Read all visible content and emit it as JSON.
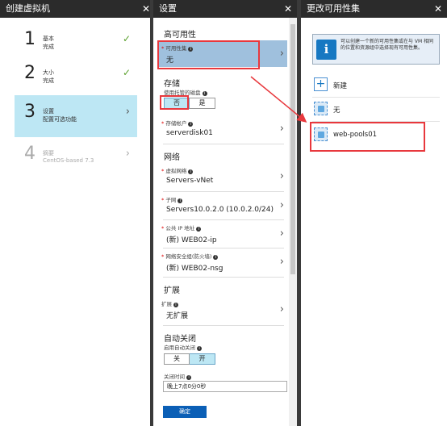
{
  "blade1": {
    "title": "创建虚拟机",
    "steps": [
      {
        "num": "1",
        "title": "基本",
        "sub": "完成"
      },
      {
        "num": "2",
        "title": "大小",
        "sub": "完成"
      },
      {
        "num": "3",
        "title": "设置",
        "sub": "配置可选功能"
      },
      {
        "num": "4",
        "title": "摘要",
        "sub": "CentOS-based 7.3"
      }
    ]
  },
  "blade2": {
    "title": "设置",
    "ha_section": "高可用性",
    "availability_set_label": "可用性集",
    "availability_set_value": "无",
    "storage_section": "存储",
    "managed_disk_label": "使用托管的磁盘",
    "managed_no": "否",
    "managed_yes": "是",
    "storage_account_label": "存储帐户",
    "storage_account_value": "serverdisk01",
    "network_section": "网络",
    "vnet_label": "虚拟网络",
    "vnet_value": "Servers-vNet",
    "subnet_label": "子网",
    "subnet_value": "Servers10.0.2.0 (10.0.2.0/24)",
    "public_ip_label": "公共 IP 地址",
    "public_ip_value": "(新) WEB02-ip",
    "nsg_label": "网络安全组(防火墙)",
    "nsg_value": "(新) WEB02-nsg",
    "ext_section": "扩展",
    "ext_label": "扩展",
    "ext_value": "无扩展",
    "autoshutdown_section": "自动关闭",
    "autoshutdown_label": "启用自动关闭",
    "off": "关",
    "on": "开",
    "shutdown_time_label": "关闭时间",
    "shutdown_time_value": "晚上7点0分0秒",
    "ok_button": "确定"
  },
  "blade3": {
    "title": "更改可用性集",
    "info_text": "可以创建一个新的可用性集或在与 VM 相同的位置和资源组中选择现有可用性集。",
    "new_label": "新建",
    "none_label": "无",
    "pool_label": "web-pools01"
  },
  "colors": {
    "header_bg": "#2b2b2b",
    "selected_step": "#bde7f4",
    "selected_field": "#9fc0dd",
    "highlight_red": "#e8383d",
    "primary_button": "#0b5fb6",
    "check_green": "#5aa02c"
  }
}
